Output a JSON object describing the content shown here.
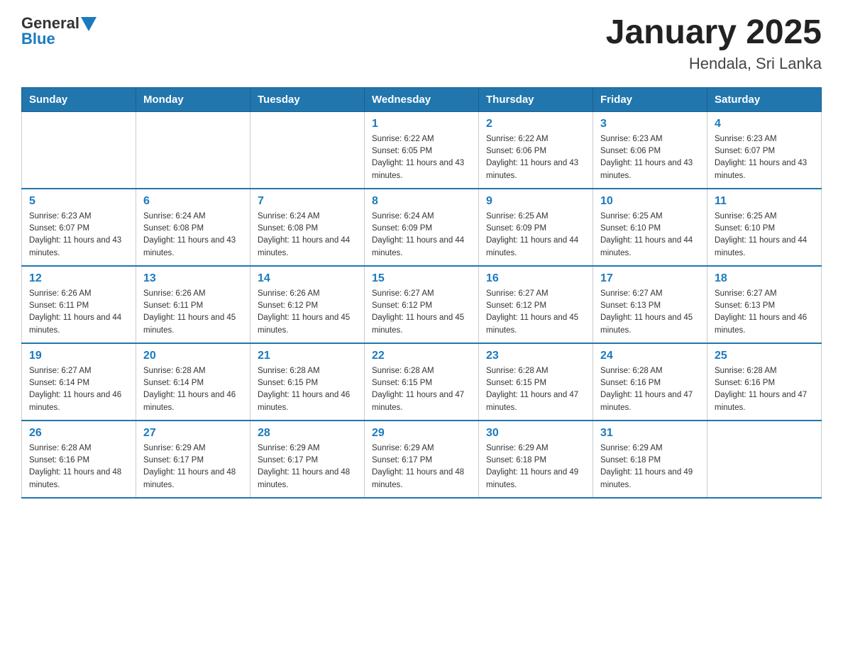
{
  "header": {
    "logo": {
      "text_general": "General",
      "text_blue": "Blue"
    },
    "title": "January 2025",
    "subtitle": "Hendala, Sri Lanka"
  },
  "weekdays": [
    "Sunday",
    "Monday",
    "Tuesday",
    "Wednesday",
    "Thursday",
    "Friday",
    "Saturday"
  ],
  "weeks": [
    [
      {
        "day": "",
        "info": ""
      },
      {
        "day": "",
        "info": ""
      },
      {
        "day": "",
        "info": ""
      },
      {
        "day": "1",
        "info": "Sunrise: 6:22 AM\nSunset: 6:05 PM\nDaylight: 11 hours and 43 minutes."
      },
      {
        "day": "2",
        "info": "Sunrise: 6:22 AM\nSunset: 6:06 PM\nDaylight: 11 hours and 43 minutes."
      },
      {
        "day": "3",
        "info": "Sunrise: 6:23 AM\nSunset: 6:06 PM\nDaylight: 11 hours and 43 minutes."
      },
      {
        "day": "4",
        "info": "Sunrise: 6:23 AM\nSunset: 6:07 PM\nDaylight: 11 hours and 43 minutes."
      }
    ],
    [
      {
        "day": "5",
        "info": "Sunrise: 6:23 AM\nSunset: 6:07 PM\nDaylight: 11 hours and 43 minutes."
      },
      {
        "day": "6",
        "info": "Sunrise: 6:24 AM\nSunset: 6:08 PM\nDaylight: 11 hours and 43 minutes."
      },
      {
        "day": "7",
        "info": "Sunrise: 6:24 AM\nSunset: 6:08 PM\nDaylight: 11 hours and 44 minutes."
      },
      {
        "day": "8",
        "info": "Sunrise: 6:24 AM\nSunset: 6:09 PM\nDaylight: 11 hours and 44 minutes."
      },
      {
        "day": "9",
        "info": "Sunrise: 6:25 AM\nSunset: 6:09 PM\nDaylight: 11 hours and 44 minutes."
      },
      {
        "day": "10",
        "info": "Sunrise: 6:25 AM\nSunset: 6:10 PM\nDaylight: 11 hours and 44 minutes."
      },
      {
        "day": "11",
        "info": "Sunrise: 6:25 AM\nSunset: 6:10 PM\nDaylight: 11 hours and 44 minutes."
      }
    ],
    [
      {
        "day": "12",
        "info": "Sunrise: 6:26 AM\nSunset: 6:11 PM\nDaylight: 11 hours and 44 minutes."
      },
      {
        "day": "13",
        "info": "Sunrise: 6:26 AM\nSunset: 6:11 PM\nDaylight: 11 hours and 45 minutes."
      },
      {
        "day": "14",
        "info": "Sunrise: 6:26 AM\nSunset: 6:12 PM\nDaylight: 11 hours and 45 minutes."
      },
      {
        "day": "15",
        "info": "Sunrise: 6:27 AM\nSunset: 6:12 PM\nDaylight: 11 hours and 45 minutes."
      },
      {
        "day": "16",
        "info": "Sunrise: 6:27 AM\nSunset: 6:12 PM\nDaylight: 11 hours and 45 minutes."
      },
      {
        "day": "17",
        "info": "Sunrise: 6:27 AM\nSunset: 6:13 PM\nDaylight: 11 hours and 45 minutes."
      },
      {
        "day": "18",
        "info": "Sunrise: 6:27 AM\nSunset: 6:13 PM\nDaylight: 11 hours and 46 minutes."
      }
    ],
    [
      {
        "day": "19",
        "info": "Sunrise: 6:27 AM\nSunset: 6:14 PM\nDaylight: 11 hours and 46 minutes."
      },
      {
        "day": "20",
        "info": "Sunrise: 6:28 AM\nSunset: 6:14 PM\nDaylight: 11 hours and 46 minutes."
      },
      {
        "day": "21",
        "info": "Sunrise: 6:28 AM\nSunset: 6:15 PM\nDaylight: 11 hours and 46 minutes."
      },
      {
        "day": "22",
        "info": "Sunrise: 6:28 AM\nSunset: 6:15 PM\nDaylight: 11 hours and 47 minutes."
      },
      {
        "day": "23",
        "info": "Sunrise: 6:28 AM\nSunset: 6:15 PM\nDaylight: 11 hours and 47 minutes."
      },
      {
        "day": "24",
        "info": "Sunrise: 6:28 AM\nSunset: 6:16 PM\nDaylight: 11 hours and 47 minutes."
      },
      {
        "day": "25",
        "info": "Sunrise: 6:28 AM\nSunset: 6:16 PM\nDaylight: 11 hours and 47 minutes."
      }
    ],
    [
      {
        "day": "26",
        "info": "Sunrise: 6:28 AM\nSunset: 6:16 PM\nDaylight: 11 hours and 48 minutes."
      },
      {
        "day": "27",
        "info": "Sunrise: 6:29 AM\nSunset: 6:17 PM\nDaylight: 11 hours and 48 minutes."
      },
      {
        "day": "28",
        "info": "Sunrise: 6:29 AM\nSunset: 6:17 PM\nDaylight: 11 hours and 48 minutes."
      },
      {
        "day": "29",
        "info": "Sunrise: 6:29 AM\nSunset: 6:17 PM\nDaylight: 11 hours and 48 minutes."
      },
      {
        "day": "30",
        "info": "Sunrise: 6:29 AM\nSunset: 6:18 PM\nDaylight: 11 hours and 49 minutes."
      },
      {
        "day": "31",
        "info": "Sunrise: 6:29 AM\nSunset: 6:18 PM\nDaylight: 11 hours and 49 minutes."
      },
      {
        "day": "",
        "info": ""
      }
    ]
  ]
}
